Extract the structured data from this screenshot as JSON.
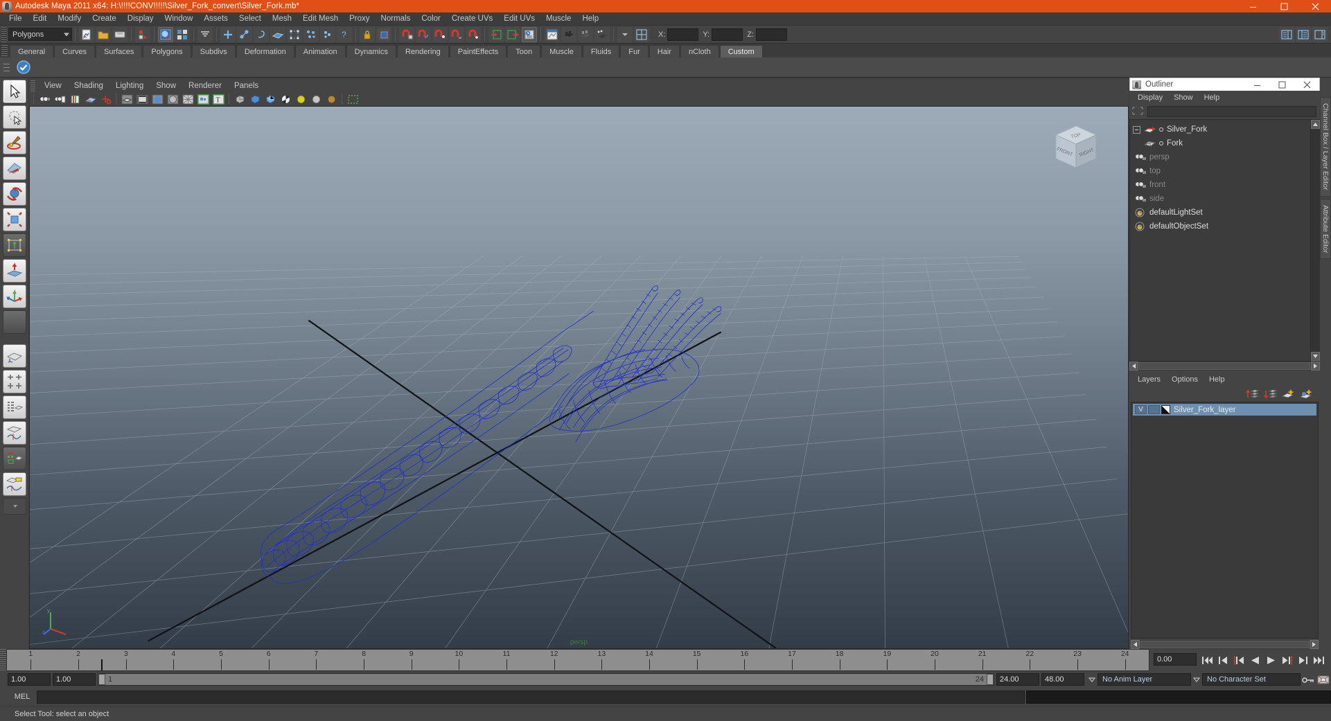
{
  "titlebar": {
    "app_icon": "maya-icon",
    "title": "Autodesk Maya 2011 x64: H:\\!!!!CONV!!!!!\\Silver_Fork_convert\\Silver_Fork.mb*",
    "minimize_label": "─",
    "maximize_label": "☐",
    "close_label": "✕",
    "accent_color": "#e04f16"
  },
  "menubar": {
    "items": [
      {
        "label": "File"
      },
      {
        "label": "Edit"
      },
      {
        "label": "Modify"
      },
      {
        "label": "Create"
      },
      {
        "label": "Display"
      },
      {
        "label": "Window"
      },
      {
        "label": "Assets"
      },
      {
        "label": "Select"
      },
      {
        "label": "Mesh"
      },
      {
        "label": "Edit Mesh"
      },
      {
        "label": "Proxy"
      },
      {
        "label": "Normals"
      },
      {
        "label": "Color"
      },
      {
        "label": "Create UVs"
      },
      {
        "label": "Edit UVs"
      },
      {
        "label": "Muscle"
      },
      {
        "label": "Help"
      }
    ]
  },
  "statusline": {
    "menu_set": "Polygons",
    "coords": [
      {
        "label": "X:",
        "value": ""
      },
      {
        "label": "Y:",
        "value": ""
      },
      {
        "label": "Z:",
        "value": ""
      }
    ]
  },
  "shelf": {
    "tabs": [
      {
        "label": "General"
      },
      {
        "label": "Curves"
      },
      {
        "label": "Surfaces"
      },
      {
        "label": "Polygons"
      },
      {
        "label": "Subdivs"
      },
      {
        "label": "Deformation"
      },
      {
        "label": "Animation"
      },
      {
        "label": "Dynamics"
      },
      {
        "label": "Rendering"
      },
      {
        "label": "PaintEffects"
      },
      {
        "label": "Toon"
      },
      {
        "label": "Muscle"
      },
      {
        "label": "Fluids"
      },
      {
        "label": "Fur"
      },
      {
        "label": "Hair"
      },
      {
        "label": "nCloth"
      },
      {
        "label": "Custom"
      }
    ],
    "active_tab": "Custom"
  },
  "viewport": {
    "menus": [
      {
        "label": "View"
      },
      {
        "label": "Shading"
      },
      {
        "label": "Lighting"
      },
      {
        "label": "Show"
      },
      {
        "label": "Renderer"
      },
      {
        "label": "Panels"
      }
    ],
    "camera_label": "persp",
    "axis": {
      "x": "x",
      "y": "y",
      "z": "z"
    },
    "viewcube": {
      "top": "TOP",
      "front": "FRONT",
      "right": "RIGHT"
    },
    "wireframe_color": "#2033c8",
    "object": "Silver Fork wireframe"
  },
  "outliner": {
    "window_title": "Outliner",
    "menus": [
      {
        "label": "Display"
      },
      {
        "label": "Show"
      },
      {
        "label": "Help"
      }
    ],
    "filter_value": "",
    "nodes": [
      {
        "label": "Silver_Fork",
        "icon": "transform-icon",
        "dim": false,
        "expander": true,
        "child": false
      },
      {
        "label": "Fork",
        "icon": "mesh-icon",
        "dim": false,
        "expander": false,
        "child": true
      },
      {
        "label": "persp",
        "icon": "camera-icon",
        "dim": true,
        "expander": false,
        "child": false
      },
      {
        "label": "top",
        "icon": "camera-icon",
        "dim": true,
        "expander": false,
        "child": false
      },
      {
        "label": "front",
        "icon": "camera-icon",
        "dim": true,
        "expander": false,
        "child": false
      },
      {
        "label": "side",
        "icon": "camera-icon",
        "dim": true,
        "expander": false,
        "child": false
      },
      {
        "label": "defaultLightSet",
        "icon": "set-icon",
        "dim": false,
        "expander": false,
        "child": false
      },
      {
        "label": "defaultObjectSet",
        "icon": "set-icon",
        "dim": false,
        "expander": false,
        "child": false
      }
    ]
  },
  "layer_editor": {
    "menus": [
      {
        "label": "Layers"
      },
      {
        "label": "Options"
      },
      {
        "label": "Help"
      }
    ],
    "tool_icons": [
      "move-layer-up-icon",
      "move-layer-down-icon",
      "new-layer-icon",
      "new-layer-from-selected-icon"
    ],
    "layers": [
      {
        "visibility": "V",
        "playback": "",
        "name": "Silver_Fork_layer",
        "selected": true
      }
    ]
  },
  "side_tabs": [
    {
      "label": "Channel Box / Layer Editor"
    },
    {
      "label": "Attribute Editor"
    }
  ],
  "timeline": {
    "ticks": [
      "1",
      "2",
      "3",
      "4",
      "5",
      "6",
      "7",
      "8",
      "9",
      "10",
      "11",
      "12",
      "13",
      "14",
      "15",
      "16",
      "17",
      "18",
      "19",
      "20",
      "21",
      "22",
      "23",
      "24"
    ],
    "current_frame": "0.00",
    "playback_buttons": [
      {
        "name": "go-to-start-icon"
      },
      {
        "name": "step-back-key-icon"
      },
      {
        "name": "step-back-frame-icon"
      },
      {
        "name": "play-backwards-icon"
      },
      {
        "name": "play-forwards-icon"
      },
      {
        "name": "step-forward-frame-icon"
      },
      {
        "name": "step-forward-key-icon"
      },
      {
        "name": "go-to-end-icon"
      }
    ]
  },
  "range_slider": {
    "anim_start": "1.00",
    "range_start": "1.00",
    "bar_start": "1",
    "bar_end": "24",
    "range_end": "24.00",
    "anim_end": "48.00",
    "anim_layer": "No Anim Layer",
    "character_set": "No Character Set",
    "key_icon": "auto-key-icon",
    "prefs_icon": "animation-preferences-icon"
  },
  "command_line": {
    "language_label": "MEL",
    "input_value": "",
    "output_value": ""
  },
  "statusbar": {
    "help_text": "Select Tool: select an object"
  },
  "toolbox": {
    "tools": [
      {
        "name": "select-tool",
        "selected": true
      },
      {
        "name": "lasso-select-tool",
        "selected": false
      },
      {
        "name": "paint-select-tool",
        "selected": false
      },
      {
        "name": "move-tool",
        "selected": false
      },
      {
        "name": "rotate-tool",
        "selected": false
      },
      {
        "name": "scale-tool",
        "selected": false
      },
      {
        "name": "universal-manipulator-tool",
        "selected": false
      },
      {
        "name": "soft-modification-tool",
        "selected": false
      },
      {
        "name": "show-manipulator-tool",
        "selected": false
      },
      {
        "name": "last-tool-used",
        "selected": false
      }
    ],
    "layouts": [
      {
        "name": "single-perspective-layout"
      },
      {
        "name": "four-view-layout"
      },
      {
        "name": "outliner-persp-layout"
      },
      {
        "name": "persp-graph-layout"
      },
      {
        "name": "hypershade-persp-layout"
      },
      {
        "name": "persp-trax-layout"
      }
    ]
  }
}
